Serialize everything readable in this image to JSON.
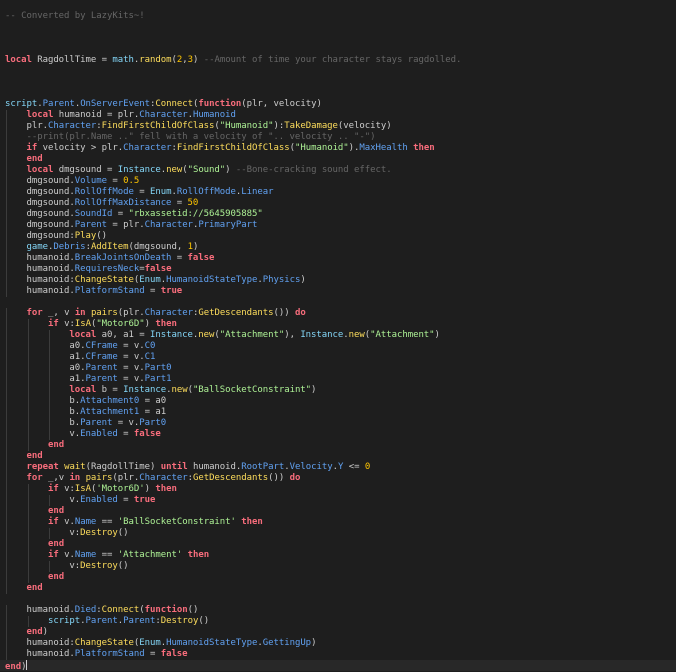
{
  "editor": {
    "language": "lua",
    "line_count": 60,
    "current_line": 60,
    "colors": {
      "background": "#1e1e1e",
      "current_line": "#282828",
      "keyword": "#f86d7c",
      "comment": "#666666",
      "string": "#adf195",
      "number": "#ffc600",
      "function_call": "#fddd5c",
      "property": "#61a1f1",
      "builtin": "#84d6f7",
      "identifier": "#cccccc"
    }
  },
  "lines": [
    [
      [
        "cm",
        "-- Converted by LazyKits~!"
      ]
    ],
    [],
    [],
    [],
    [
      [
        "kw",
        "local"
      ],
      [
        "id",
        " RagdollTime "
      ],
      [
        "op",
        "= "
      ],
      [
        "bi",
        "math"
      ],
      [
        "op",
        "."
      ],
      [
        "fn",
        "random"
      ],
      [
        "op",
        "("
      ],
      [
        "num",
        "2"
      ],
      [
        "op",
        ","
      ],
      [
        "num",
        "3"
      ],
      [
        "op",
        ") "
      ],
      [
        "cm",
        "--Amount of time your character stays ragdolled."
      ]
    ],
    [],
    [],
    [],
    [
      [
        "bi",
        "script"
      ],
      [
        "op",
        "."
      ],
      [
        "prop",
        "Parent"
      ],
      [
        "op",
        "."
      ],
      [
        "prop",
        "OnServerEvent"
      ],
      [
        "op",
        ":"
      ],
      [
        "fn",
        "Connect"
      ],
      [
        "op",
        "("
      ],
      [
        "kw",
        "function"
      ],
      [
        "op",
        "("
      ],
      [
        "id",
        "plr, velocity"
      ],
      [
        "op",
        ")"
      ]
    ],
    [
      [
        "id",
        "    "
      ],
      [
        "kw",
        "local"
      ],
      [
        "id",
        " humanoid "
      ],
      [
        "op",
        "= "
      ],
      [
        "id",
        "plr"
      ],
      [
        "op",
        "."
      ],
      [
        "prop",
        "Character"
      ],
      [
        "op",
        "."
      ],
      [
        "prop",
        "Humanoid"
      ]
    ],
    [
      [
        "id",
        "    plr"
      ],
      [
        "op",
        "."
      ],
      [
        "prop",
        "Character"
      ],
      [
        "op",
        ":"
      ],
      [
        "fn",
        "FindFirstChildOfClass"
      ],
      [
        "op",
        "("
      ],
      [
        "str",
        "\"Humanoid\""
      ],
      [
        "op",
        "):"
      ],
      [
        "fn",
        "TakeDamage"
      ],
      [
        "op",
        "("
      ],
      [
        "id",
        "velocity"
      ],
      [
        "op",
        ")"
      ]
    ],
    [
      [
        "id",
        "    "
      ],
      [
        "cm",
        "--print(plr.Name ..\" fell with a velocity of \".. velocity .. \"-\")"
      ]
    ],
    [
      [
        "id",
        "    "
      ],
      [
        "kw",
        "if"
      ],
      [
        "id",
        " velocity "
      ],
      [
        "op",
        "> "
      ],
      [
        "id",
        "plr"
      ],
      [
        "op",
        "."
      ],
      [
        "prop",
        "Character"
      ],
      [
        "op",
        ":"
      ],
      [
        "fn",
        "FindFirstChildOfClass"
      ],
      [
        "op",
        "("
      ],
      [
        "str",
        "\"Humanoid\""
      ],
      [
        "op",
        ")."
      ],
      [
        "prop",
        "MaxHealth"
      ],
      [
        "id",
        " "
      ],
      [
        "kw",
        "then"
      ]
    ],
    [
      [
        "id",
        "    "
      ],
      [
        "kw",
        "end"
      ]
    ],
    [
      [
        "id",
        "    "
      ],
      [
        "kw",
        "local"
      ],
      [
        "id",
        " dmgsound "
      ],
      [
        "op",
        "= "
      ],
      [
        "bi",
        "Instance"
      ],
      [
        "op",
        "."
      ],
      [
        "fn",
        "new"
      ],
      [
        "op",
        "("
      ],
      [
        "str",
        "\"Sound\""
      ],
      [
        "op",
        ") "
      ],
      [
        "cm",
        "--Bone-cracking sound effect."
      ]
    ],
    [
      [
        "id",
        "    dmgsound"
      ],
      [
        "op",
        "."
      ],
      [
        "prop",
        "Volume"
      ],
      [
        "op",
        " = "
      ],
      [
        "num",
        "0.5"
      ]
    ],
    [
      [
        "id",
        "    dmgsound"
      ],
      [
        "op",
        "."
      ],
      [
        "prop",
        "RollOffMode"
      ],
      [
        "op",
        " = "
      ],
      [
        "bi",
        "Enum"
      ],
      [
        "op",
        "."
      ],
      [
        "prop",
        "RollOffMode"
      ],
      [
        "op",
        "."
      ],
      [
        "prop",
        "Linear"
      ]
    ],
    [
      [
        "id",
        "    dmgsound"
      ],
      [
        "op",
        "."
      ],
      [
        "prop",
        "RollOffMaxDistance"
      ],
      [
        "op",
        " = "
      ],
      [
        "num",
        "50"
      ]
    ],
    [
      [
        "id",
        "    dmgsound"
      ],
      [
        "op",
        "."
      ],
      [
        "prop",
        "SoundId"
      ],
      [
        "op",
        " = "
      ],
      [
        "str",
        "\"rbxassetid://5645905885\""
      ]
    ],
    [
      [
        "id",
        "    dmgsound"
      ],
      [
        "op",
        "."
      ],
      [
        "prop",
        "Parent"
      ],
      [
        "op",
        " = "
      ],
      [
        "id",
        "plr"
      ],
      [
        "op",
        "."
      ],
      [
        "prop",
        "Character"
      ],
      [
        "op",
        "."
      ],
      [
        "prop",
        "PrimaryPart"
      ]
    ],
    [
      [
        "id",
        "    dmgsound"
      ],
      [
        "op",
        ":"
      ],
      [
        "fn",
        "Play"
      ],
      [
        "op",
        "()"
      ]
    ],
    [
      [
        "id",
        "    "
      ],
      [
        "bi",
        "game"
      ],
      [
        "op",
        "."
      ],
      [
        "prop",
        "Debris"
      ],
      [
        "op",
        ":"
      ],
      [
        "fn",
        "AddItem"
      ],
      [
        "op",
        "("
      ],
      [
        "id",
        "dmgsound, "
      ],
      [
        "num",
        "1"
      ],
      [
        "op",
        ")"
      ]
    ],
    [
      [
        "id",
        "    humanoid"
      ],
      [
        "op",
        "."
      ],
      [
        "prop",
        "BreakJointsOnDeath"
      ],
      [
        "op",
        " = "
      ],
      [
        "kw",
        "false"
      ]
    ],
    [
      [
        "id",
        "    humanoid"
      ],
      [
        "op",
        "."
      ],
      [
        "prop",
        "RequiresNeck"
      ],
      [
        "op",
        "="
      ],
      [
        "kw",
        "false"
      ]
    ],
    [
      [
        "id",
        "    humanoid"
      ],
      [
        "op",
        ":"
      ],
      [
        "fn",
        "ChangeState"
      ],
      [
        "op",
        "("
      ],
      [
        "bi",
        "Enum"
      ],
      [
        "op",
        "."
      ],
      [
        "prop",
        "HumanoidStateType"
      ],
      [
        "op",
        "."
      ],
      [
        "prop",
        "Physics"
      ],
      [
        "op",
        ")"
      ]
    ],
    [
      [
        "id",
        "    humanoid"
      ],
      [
        "op",
        "."
      ],
      [
        "prop",
        "PlatformStand"
      ],
      [
        "op",
        " = "
      ],
      [
        "kw",
        "true"
      ]
    ],
    [],
    [
      [
        "id",
        "    "
      ],
      [
        "kw",
        "for"
      ],
      [
        "id",
        " _, v "
      ],
      [
        "kw",
        "in"
      ],
      [
        "id",
        " "
      ],
      [
        "fn",
        "pairs"
      ],
      [
        "op",
        "("
      ],
      [
        "id",
        "plr"
      ],
      [
        "op",
        "."
      ],
      [
        "prop",
        "Character"
      ],
      [
        "op",
        ":"
      ],
      [
        "fn",
        "GetDescendants"
      ],
      [
        "op",
        "()) "
      ],
      [
        "kw",
        "do"
      ]
    ],
    [
      [
        "id",
        "        "
      ],
      [
        "kw",
        "if"
      ],
      [
        "id",
        " v"
      ],
      [
        "op",
        ":"
      ],
      [
        "fn",
        "IsA"
      ],
      [
        "op",
        "("
      ],
      [
        "str",
        "\"Motor6D\""
      ],
      [
        "op",
        ") "
      ],
      [
        "kw",
        "then"
      ]
    ],
    [
      [
        "id",
        "            "
      ],
      [
        "kw",
        "local"
      ],
      [
        "id",
        " a0, a1 "
      ],
      [
        "op",
        "= "
      ],
      [
        "bi",
        "Instance"
      ],
      [
        "op",
        "."
      ],
      [
        "fn",
        "new"
      ],
      [
        "op",
        "("
      ],
      [
        "str",
        "\"Attachment\""
      ],
      [
        "op",
        "), "
      ],
      [
        "bi",
        "Instance"
      ],
      [
        "op",
        "."
      ],
      [
        "fn",
        "new"
      ],
      [
        "op",
        "("
      ],
      [
        "str",
        "\"Attachment\""
      ],
      [
        "op",
        ")"
      ]
    ],
    [
      [
        "id",
        "            a0"
      ],
      [
        "op",
        "."
      ],
      [
        "prop",
        "CFrame"
      ],
      [
        "op",
        " = "
      ],
      [
        "id",
        "v"
      ],
      [
        "op",
        "."
      ],
      [
        "prop",
        "C0"
      ]
    ],
    [
      [
        "id",
        "            a1"
      ],
      [
        "op",
        "."
      ],
      [
        "prop",
        "CFrame"
      ],
      [
        "op",
        " = "
      ],
      [
        "id",
        "v"
      ],
      [
        "op",
        "."
      ],
      [
        "prop",
        "C1"
      ]
    ],
    [
      [
        "id",
        "            a0"
      ],
      [
        "op",
        "."
      ],
      [
        "prop",
        "Parent"
      ],
      [
        "op",
        " = "
      ],
      [
        "id",
        "v"
      ],
      [
        "op",
        "."
      ],
      [
        "prop",
        "Part0"
      ]
    ],
    [
      [
        "id",
        "            a1"
      ],
      [
        "op",
        "."
      ],
      [
        "prop",
        "Parent"
      ],
      [
        "op",
        " = "
      ],
      [
        "id",
        "v"
      ],
      [
        "op",
        "."
      ],
      [
        "prop",
        "Part1"
      ]
    ],
    [
      [
        "id",
        "            "
      ],
      [
        "kw",
        "local"
      ],
      [
        "id",
        " b "
      ],
      [
        "op",
        "= "
      ],
      [
        "bi",
        "Instance"
      ],
      [
        "op",
        "."
      ],
      [
        "fn",
        "new"
      ],
      [
        "op",
        "("
      ],
      [
        "str",
        "\"BallSocketConstraint\""
      ],
      [
        "op",
        ")"
      ]
    ],
    [
      [
        "id",
        "            b"
      ],
      [
        "op",
        "."
      ],
      [
        "prop",
        "Attachment0"
      ],
      [
        "op",
        " = "
      ],
      [
        "id",
        "a0"
      ]
    ],
    [
      [
        "id",
        "            b"
      ],
      [
        "op",
        "."
      ],
      [
        "prop",
        "Attachment1"
      ],
      [
        "op",
        " = "
      ],
      [
        "id",
        "a1"
      ]
    ],
    [
      [
        "id",
        "            b"
      ],
      [
        "op",
        "."
      ],
      [
        "prop",
        "Parent"
      ],
      [
        "op",
        " = "
      ],
      [
        "id",
        "v"
      ],
      [
        "op",
        "."
      ],
      [
        "prop",
        "Part0"
      ]
    ],
    [
      [
        "id",
        "            v"
      ],
      [
        "op",
        "."
      ],
      [
        "prop",
        "Enabled"
      ],
      [
        "op",
        " = "
      ],
      [
        "kw",
        "false"
      ]
    ],
    [
      [
        "id",
        "        "
      ],
      [
        "kw",
        "end"
      ]
    ],
    [
      [
        "id",
        "    "
      ],
      [
        "kw",
        "end"
      ]
    ],
    [
      [
        "id",
        "    "
      ],
      [
        "kw",
        "repeat"
      ],
      [
        "id",
        " "
      ],
      [
        "fn",
        "wait"
      ],
      [
        "op",
        "("
      ],
      [
        "id",
        "RagdollTime"
      ],
      [
        "op",
        ") "
      ],
      [
        "kw",
        "until"
      ],
      [
        "id",
        " humanoid"
      ],
      [
        "op",
        "."
      ],
      [
        "prop",
        "RootPart"
      ],
      [
        "op",
        "."
      ],
      [
        "prop",
        "Velocity"
      ],
      [
        "op",
        "."
      ],
      [
        "prop",
        "Y"
      ],
      [
        "op",
        " <= "
      ],
      [
        "num",
        "0"
      ]
    ],
    [
      [
        "id",
        "    "
      ],
      [
        "kw",
        "for"
      ],
      [
        "id",
        " _,v "
      ],
      [
        "kw",
        "in"
      ],
      [
        "id",
        " "
      ],
      [
        "fn",
        "pairs"
      ],
      [
        "op",
        "("
      ],
      [
        "id",
        "plr"
      ],
      [
        "op",
        "."
      ],
      [
        "prop",
        "Character"
      ],
      [
        "op",
        ":"
      ],
      [
        "fn",
        "GetDescendants"
      ],
      [
        "op",
        "()) "
      ],
      [
        "kw",
        "do"
      ]
    ],
    [
      [
        "id",
        "        "
      ],
      [
        "kw",
        "if"
      ],
      [
        "id",
        " v"
      ],
      [
        "op",
        ":"
      ],
      [
        "fn",
        "IsA"
      ],
      [
        "op",
        "("
      ],
      [
        "str",
        "'Motor6D'"
      ],
      [
        "op",
        ") "
      ],
      [
        "kw",
        "then"
      ]
    ],
    [
      [
        "id",
        "            v"
      ],
      [
        "op",
        "."
      ],
      [
        "prop",
        "Enabled"
      ],
      [
        "op",
        " = "
      ],
      [
        "kw",
        "true"
      ]
    ],
    [
      [
        "id",
        "        "
      ],
      [
        "kw",
        "end"
      ]
    ],
    [
      [
        "id",
        "        "
      ],
      [
        "kw",
        "if"
      ],
      [
        "id",
        " v"
      ],
      [
        "op",
        "."
      ],
      [
        "prop",
        "Name"
      ],
      [
        "op",
        " == "
      ],
      [
        "str",
        "'BallSocketConstraint'"
      ],
      [
        "id",
        " "
      ],
      [
        "kw",
        "then"
      ]
    ],
    [
      [
        "id",
        "            v"
      ],
      [
        "op",
        ":"
      ],
      [
        "fn",
        "Destroy"
      ],
      [
        "op",
        "()"
      ]
    ],
    [
      [
        "id",
        "        "
      ],
      [
        "kw",
        "end"
      ]
    ],
    [
      [
        "id",
        "        "
      ],
      [
        "kw",
        "if"
      ],
      [
        "id",
        " v"
      ],
      [
        "op",
        "."
      ],
      [
        "prop",
        "Name"
      ],
      [
        "op",
        " == "
      ],
      [
        "str",
        "'Attachment'"
      ],
      [
        "id",
        " "
      ],
      [
        "kw",
        "then"
      ]
    ],
    [
      [
        "id",
        "            v"
      ],
      [
        "op",
        ":"
      ],
      [
        "fn",
        "Destroy"
      ],
      [
        "op",
        "()"
      ]
    ],
    [
      [
        "id",
        "        "
      ],
      [
        "kw",
        "end"
      ]
    ],
    [
      [
        "id",
        "    "
      ],
      [
        "kw",
        "end"
      ]
    ],
    [],
    [
      [
        "id",
        "    humanoid"
      ],
      [
        "op",
        "."
      ],
      [
        "prop",
        "Died"
      ],
      [
        "op",
        ":"
      ],
      [
        "fn",
        "Connect"
      ],
      [
        "op",
        "("
      ],
      [
        "kw",
        "function"
      ],
      [
        "op",
        "()"
      ]
    ],
    [
      [
        "id",
        "        "
      ],
      [
        "bi",
        "script"
      ],
      [
        "op",
        "."
      ],
      [
        "prop",
        "Parent"
      ],
      [
        "op",
        "."
      ],
      [
        "prop",
        "Parent"
      ],
      [
        "op",
        ":"
      ],
      [
        "fn",
        "Destroy"
      ],
      [
        "op",
        "()"
      ]
    ],
    [
      [
        "id",
        "    "
      ],
      [
        "kw",
        "end"
      ],
      [
        "op",
        ")"
      ]
    ],
    [
      [
        "id",
        "    humanoid"
      ],
      [
        "op",
        ":"
      ],
      [
        "fn",
        "ChangeState"
      ],
      [
        "op",
        "("
      ],
      [
        "bi",
        "Enum"
      ],
      [
        "op",
        "."
      ],
      [
        "prop",
        "HumanoidStateType"
      ],
      [
        "op",
        "."
      ],
      [
        "prop",
        "GettingUp"
      ],
      [
        "op",
        ")"
      ]
    ],
    [
      [
        "id",
        "    humanoid"
      ],
      [
        "op",
        "."
      ],
      [
        "prop",
        "PlatformStand"
      ],
      [
        "op",
        " = "
      ],
      [
        "kw",
        "false"
      ]
    ],
    [
      [
        "kw",
        "end"
      ],
      [
        "op",
        ")"
      ]
    ]
  ]
}
